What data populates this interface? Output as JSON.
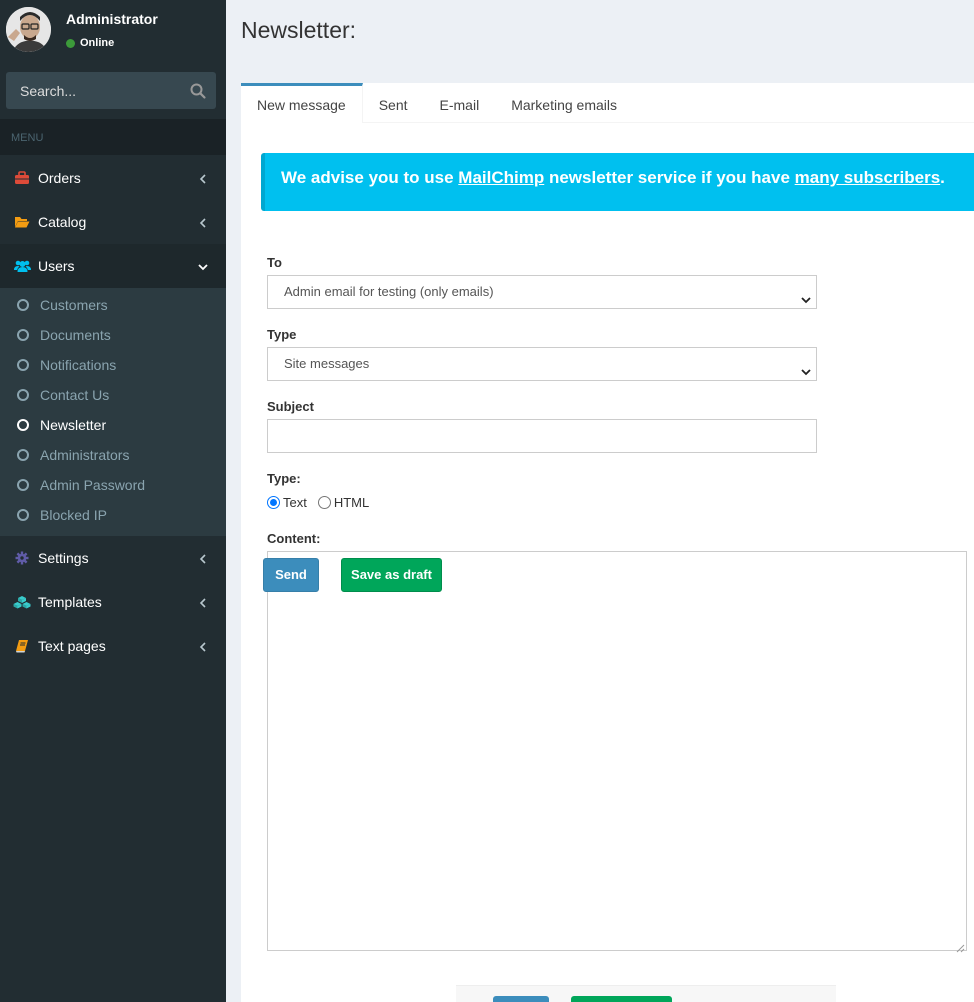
{
  "user": {
    "name": "Administrator",
    "status": "Online"
  },
  "search": {
    "placeholder": "Search..."
  },
  "menu_header": "MENU",
  "menu": {
    "orders": "Orders",
    "catalog": "Catalog",
    "users": "Users",
    "users_sub": [
      "Customers",
      "Documents",
      "Notifications",
      "Contact Us",
      "Newsletter",
      "Administrators",
      "Admin Password",
      "Blocked IP"
    ],
    "settings": "Settings",
    "templates": "Templates",
    "text_pages": "Text pages"
  },
  "page": {
    "title": "Newsletter:"
  },
  "tabs": [
    "New message",
    "Sent",
    "E-mail",
    "Marketing emails"
  ],
  "alert": {
    "prefix": "We advise you to use ",
    "link1": "MailChimp",
    "middle": " newsletter service if you have ",
    "link2": "many subscribers",
    "suffix": "."
  },
  "form": {
    "to_label": "To",
    "to_value": "Admin email for testing (only emails)",
    "type_label": "Type",
    "type_value": "Site messages",
    "subject_label": "Subject",
    "subject_value": "",
    "format_label": "Type:",
    "format_options": [
      "Text",
      "HTML"
    ],
    "format_selected": "Text",
    "content_label": "Content:",
    "send_label": "Send",
    "draft_label": "Save as draft"
  },
  "colors": {
    "sidebar_bg": "#222d32",
    "accent_blue": "#3c8dbc",
    "alert_bg": "#00c0ef",
    "success_green": "#00a65a",
    "status_online": "#3c9a3a"
  }
}
